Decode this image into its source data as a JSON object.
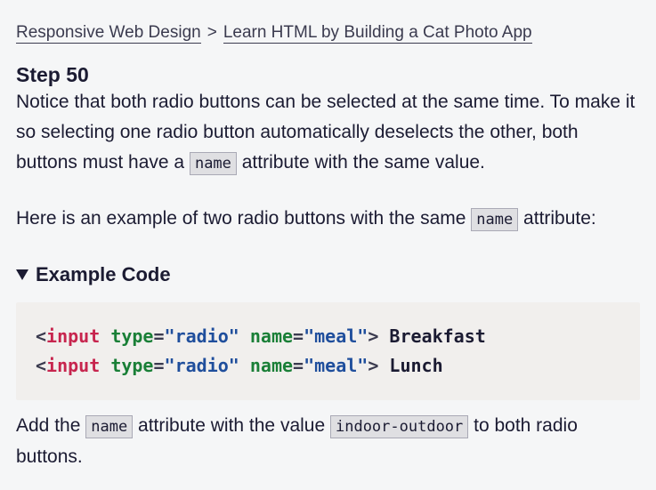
{
  "breadcrumb": {
    "course": "Responsive Web Design",
    "separator": ">",
    "project": "Learn HTML by Building a Cat Photo App"
  },
  "step": {
    "title": "Step 50"
  },
  "paragraph1": {
    "before": "Notice that both radio buttons can be selected at the same time. To make it so selecting one radio button automatically deselects the other, both buttons must have a ",
    "code": "name",
    "after": " attribute with the same value."
  },
  "paragraph2": {
    "before": "Here is an example of two radio buttons with the same ",
    "code": "name",
    "after": " attribute:"
  },
  "example": {
    "summary": "Example Code",
    "lines": [
      {
        "open": "<",
        "tag": "input",
        "attr1": "type",
        "eq1": "=",
        "val1": "\"radio\"",
        "attr2": "name",
        "eq2": "=",
        "val2": "\"meal\"",
        "close": ">",
        "text": " Breakfast"
      },
      {
        "open": "<",
        "tag": "input",
        "attr1": "type",
        "eq1": "=",
        "val1": "\"radio\"",
        "attr2": "name",
        "eq2": "=",
        "val2": "\"meal\"",
        "close": ">",
        "text": " Lunch"
      }
    ]
  },
  "paragraph3": {
    "before": "Add the ",
    "code1": "name",
    "middle": " attribute with the value ",
    "code2": "indoor-outdoor",
    "after": " to both radio buttons."
  },
  "colors": {
    "background": "#f5f6f7",
    "text": "#1b1b32",
    "code_background": "#f1efed",
    "tag": "#c7254e",
    "attribute": "#1a7f37",
    "value": "#1f4e9c"
  }
}
